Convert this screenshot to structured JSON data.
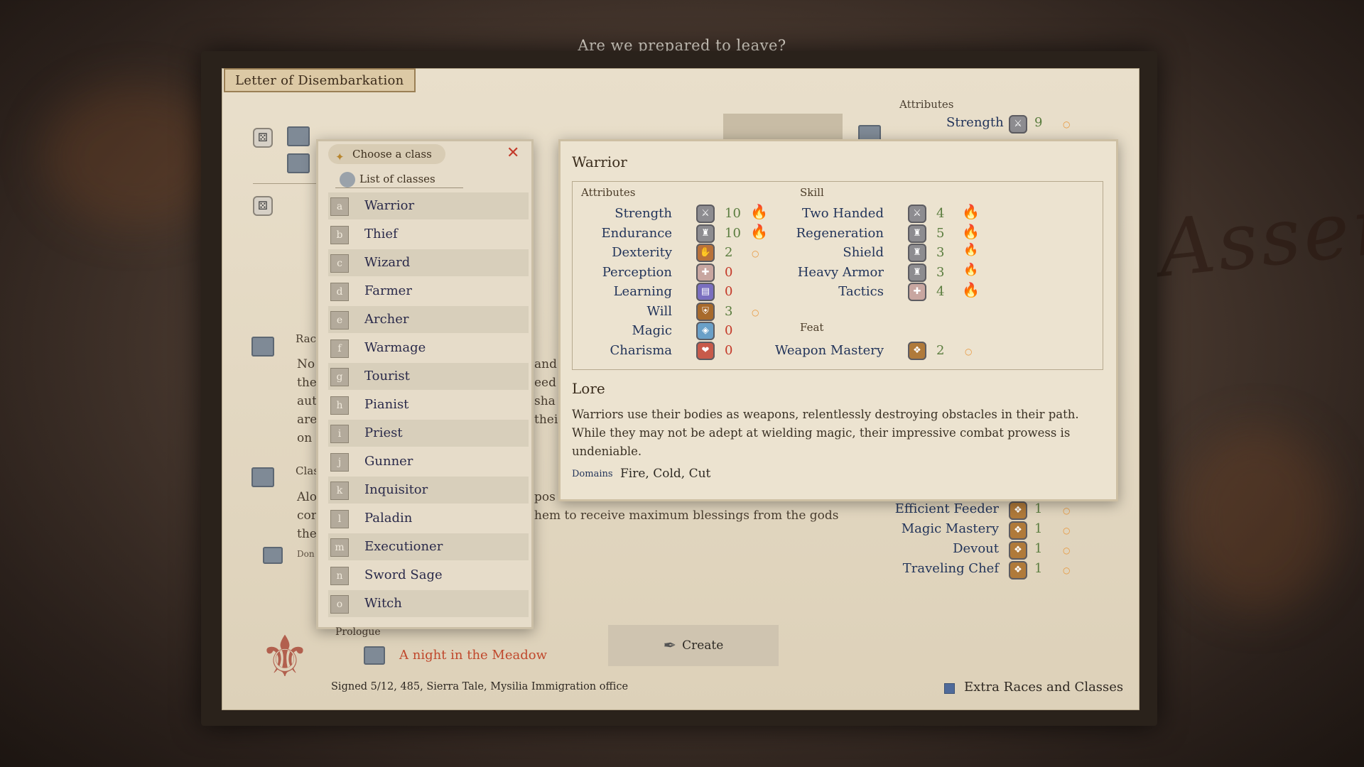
{
  "window": {
    "question": "Are we prepared to leave?",
    "map_text": "Asser"
  },
  "letter": {
    "title": "Letter of Disembarkation",
    "bg_lines": {
      "race_label": "Rac",
      "race_lines": [
        "No",
        "the",
        "aut",
        "are",
        "on"
      ],
      "race_right": [
        "and",
        "eed",
        "sha",
        "thei"
      ],
      "class_label": "Clas",
      "class_lines": [
        "Alo",
        "cor",
        "the"
      ],
      "class_right": "pos",
      "class_sentence": "hem to receive maximum blessings from the gods",
      "domains_small": "Don"
    },
    "attributes_label": "Attributes",
    "strength_label": "Strength",
    "strength_value": "9",
    "feats": [
      {
        "name": "Efficient Feeder",
        "value": "1"
      },
      {
        "name": "Magic Mastery",
        "value": "1"
      },
      {
        "name": "Devout",
        "value": "1"
      },
      {
        "name": "Traveling Chef",
        "value": "1"
      }
    ],
    "prologue_label": "Prologue",
    "prologue_value": "A night in the Meadow",
    "create_label": "Create",
    "signed": "Signed 5/12, 485, Sierra Tale, Mysilia Immigration office",
    "extra_label": "Extra Races and Classes"
  },
  "class_panel": {
    "header": "Choose a class",
    "list_title": "List of classes",
    "classes": [
      {
        "key": "a",
        "name": "Warrior"
      },
      {
        "key": "b",
        "name": "Thief"
      },
      {
        "key": "c",
        "name": "Wizard"
      },
      {
        "key": "d",
        "name": "Farmer"
      },
      {
        "key": "e",
        "name": "Archer"
      },
      {
        "key": "f",
        "name": "Warmage"
      },
      {
        "key": "g",
        "name": "Tourist"
      },
      {
        "key": "h",
        "name": "Pianist"
      },
      {
        "key": "i",
        "name": "Priest"
      },
      {
        "key": "j",
        "name": "Gunner"
      },
      {
        "key": "k",
        "name": "Inquisitor"
      },
      {
        "key": "l",
        "name": "Paladin"
      },
      {
        "key": "m",
        "name": "Executioner"
      },
      {
        "key": "n",
        "name": "Sword Sage"
      },
      {
        "key": "o",
        "name": "Witch"
      }
    ]
  },
  "detail": {
    "title": "Warrior",
    "attributes_label": "Attributes",
    "skill_label": "Skill",
    "feat_label": "Feat",
    "attributes": [
      {
        "name": "Strength",
        "value": "10",
        "icon": "strength-icon"
      },
      {
        "name": "Endurance",
        "value": "10",
        "icon": "endurance-icon"
      },
      {
        "name": "Dexterity",
        "value": "2",
        "icon": "dexterity-icon"
      },
      {
        "name": "Perception",
        "value": "0",
        "icon": "perception-icon"
      },
      {
        "name": "Learning",
        "value": "0",
        "icon": "learning-icon"
      },
      {
        "name": "Will",
        "value": "3",
        "icon": "will-icon"
      },
      {
        "name": "Magic",
        "value": "0",
        "icon": "magic-icon"
      },
      {
        "name": "Charisma",
        "value": "0",
        "icon": "charisma-icon"
      }
    ],
    "skills": [
      {
        "name": "Two Handed",
        "value": "4"
      },
      {
        "name": "Regeneration",
        "value": "5"
      },
      {
        "name": "Shield",
        "value": "3"
      },
      {
        "name": "Heavy Armor",
        "value": "3"
      },
      {
        "name": "Tactics",
        "value": "4"
      }
    ],
    "feat": {
      "name": "Weapon Mastery",
      "value": "2"
    },
    "lore_title": "Lore",
    "lore_text": "Warriors use their bodies as weapons, relentlessly destroying obstacles in their path. While they may not be adept at wielding magic, their impressive combat prowess is undeniable.",
    "domains_label": "Domains",
    "domains_value": "Fire, Cold, Cut"
  },
  "colors": {
    "accent_red": "#c43a2a",
    "stat_green": "#5b7d3f",
    "label_blue": "#22345a",
    "flame": "#e8963a"
  }
}
